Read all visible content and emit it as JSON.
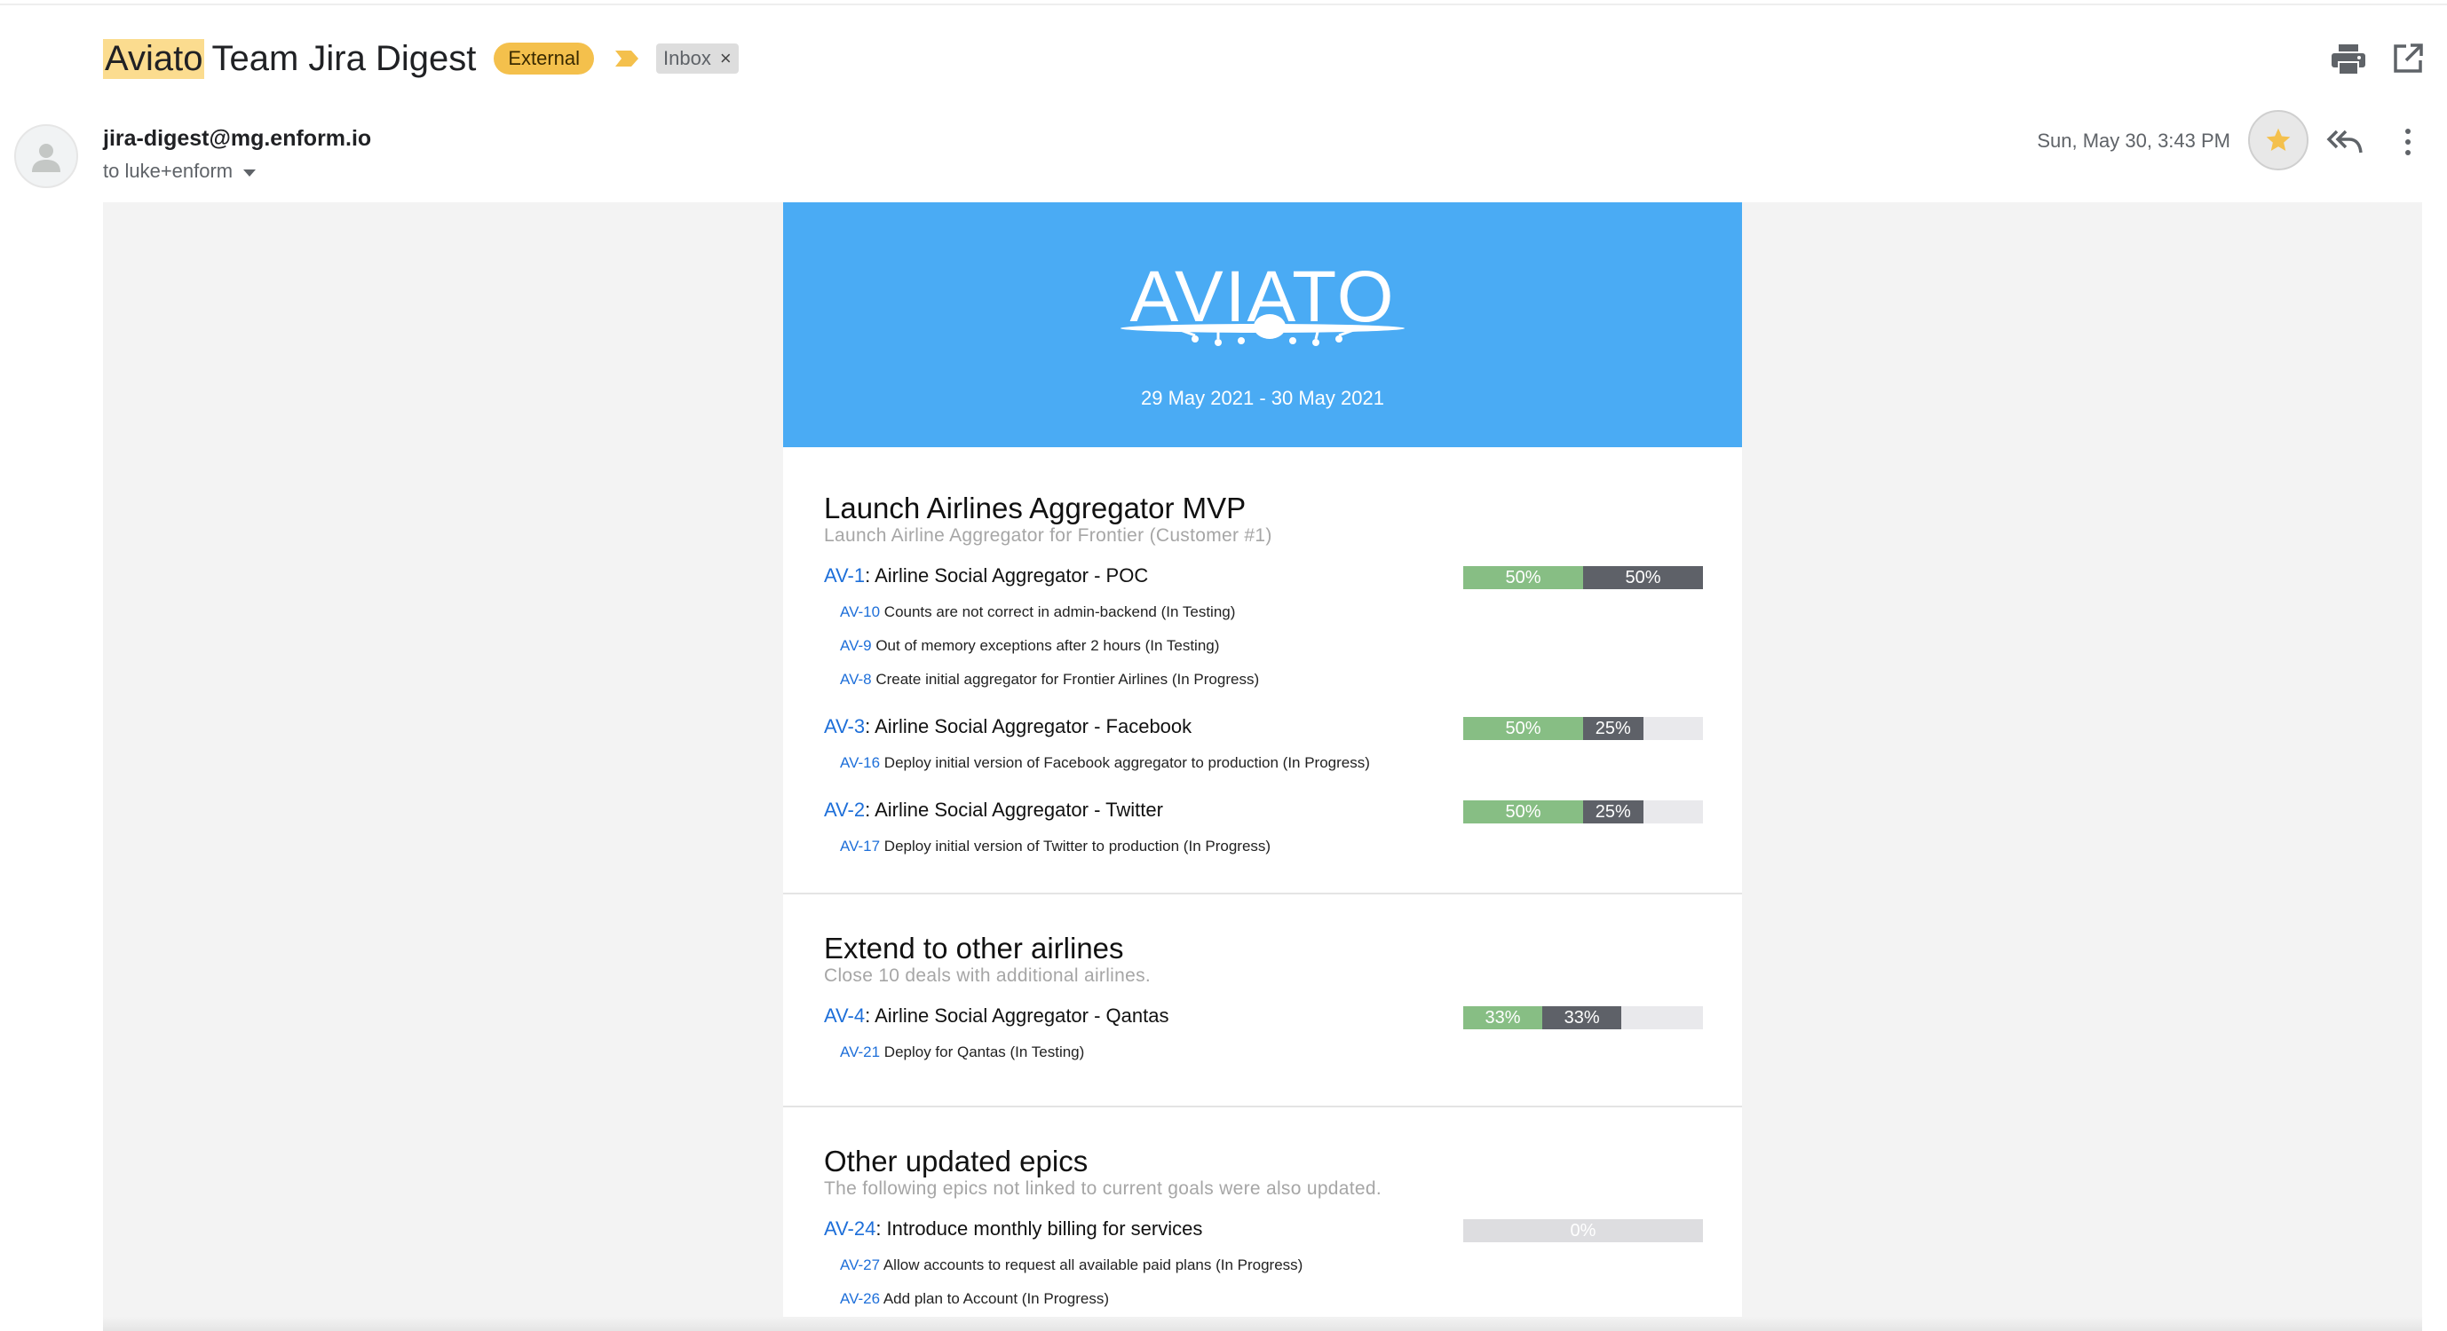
{
  "email": {
    "subject_highlight": "Aviato",
    "subject_rest": "Team Jira Digest",
    "label_external": "External",
    "label_inbox": "Inbox",
    "label_inbox_remove": "×",
    "sender": "jira-digest@mg.enform.io",
    "recipient": "to luke+enform",
    "date": "Sun, May 30, 3:43 PM"
  },
  "icons": {
    "important": "important-marker-icon",
    "print": "print-icon",
    "open_new_window": "open-in-new-window-icon",
    "avatar": "person-icon",
    "star": "star-icon",
    "reply_all": "reply-all-icon",
    "more": "more-vertical-icon"
  },
  "colors": {
    "banner": "#4aabf4",
    "done": "#87be84",
    "in_progress": "#5e6168",
    "remaining": "#e9e9ec",
    "issue_key": "#1e6fd9",
    "external_badge": "#f4c04c",
    "star": "#f4c04c"
  },
  "digest": {
    "logo_text": "AVIATO",
    "date_range": "29 May 2021 - 30 May 2021",
    "sections": [
      {
        "title": "Launch Airlines Aggregator MVP",
        "subtitle": "Launch Airline Aggregator for Frontier (Customer #1)",
        "epics": [
          {
            "key": "AV-1",
            "title": ": Airline Social Aggregator - POC",
            "done_pct": 50,
            "progress_pct": 50,
            "done_label": "50%",
            "progress_label": "50%",
            "issues": [
              {
                "key": "AV-10",
                "text": " Counts are not correct in admin-backend (In Testing)"
              },
              {
                "key": "AV-9",
                "text": " Out of memory exceptions after 2 hours (In Testing)"
              },
              {
                "key": "AV-8",
                "text": " Create initial aggregator for Frontier Airlines (In Progress)"
              }
            ]
          },
          {
            "key": "AV-3",
            "title": ": Airline Social Aggregator - Facebook",
            "done_pct": 50,
            "progress_pct": 25,
            "done_label": "50%",
            "progress_label": "25%",
            "issues": [
              {
                "key": "AV-16",
                "text": " Deploy initial version of Facebook aggregator to production (In Progress)"
              }
            ]
          },
          {
            "key": "AV-2",
            "title": ": Airline Social Aggregator - Twitter",
            "done_pct": 50,
            "progress_pct": 25,
            "done_label": "50%",
            "progress_label": "25%",
            "issues": [
              {
                "key": "AV-17",
                "text": " Deploy initial version of Twitter to production (In Progress)"
              }
            ]
          }
        ]
      },
      {
        "title": "Extend to other airlines",
        "subtitle": "Close 10 deals with additional airlines.",
        "epics": [
          {
            "key": "AV-4",
            "title": ": Airline Social Aggregator - Qantas",
            "done_pct": 33,
            "progress_pct": 33,
            "done_label": "33%",
            "progress_label": "33%",
            "issues": [
              {
                "key": "AV-21",
                "text": " Deploy for Qantas (In Testing)"
              }
            ]
          }
        ]
      },
      {
        "title": "Other updated epics",
        "subtitle": "The following epics not linked to current goals were also updated.",
        "epics": [
          {
            "key": "AV-24",
            "title": ": Introduce monthly billing for services",
            "done_pct": 0,
            "progress_pct": 0,
            "zero_label": "0%",
            "issues": [
              {
                "key": "AV-27",
                "text": " Allow accounts to request all available paid plans (In Progress)"
              },
              {
                "key": "AV-26",
                "text": " Add plan to Account (In Progress)"
              }
            ]
          }
        ]
      }
    ]
  }
}
